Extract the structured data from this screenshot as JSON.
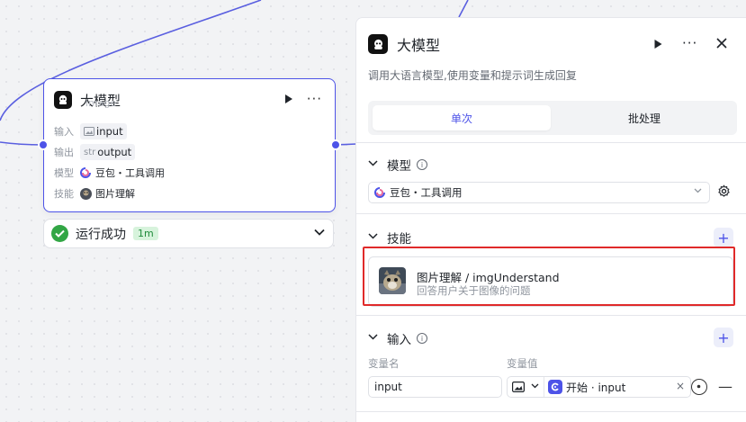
{
  "node": {
    "title": "大模型",
    "tooltip": "image",
    "rows": [
      {
        "label": "输入",
        "type_hint": "",
        "value": "input"
      },
      {
        "label": "输出",
        "type_hint": "str",
        "value": "output"
      },
      {
        "label": "模型",
        "value": "豆包・工具调用"
      },
      {
        "label": "技能",
        "value": "图片理解"
      }
    ]
  },
  "status": {
    "text": "运行成功",
    "duration": "1m"
  },
  "panel": {
    "title": "大模型",
    "description": "调用大语言模型,使用变量和提示词生成回复",
    "tabs": [
      {
        "label": "单次"
      },
      {
        "label": "批处理"
      }
    ],
    "model_section": {
      "title": "模型",
      "selected": "豆包・工具调用"
    },
    "skills_section": {
      "title": "技能",
      "skill": {
        "name": "图片理解 / imgUnderstand",
        "description": "回答用户关于图像的问题"
      }
    },
    "input_section": {
      "title": "输入",
      "col_name": "变量名",
      "col_value": "变量值",
      "name_value": "input",
      "ref_label": "开始 · input"
    }
  },
  "colors": {
    "accent": "#4d53e8",
    "success": "#32a645",
    "highlight": "#e02a2a"
  }
}
